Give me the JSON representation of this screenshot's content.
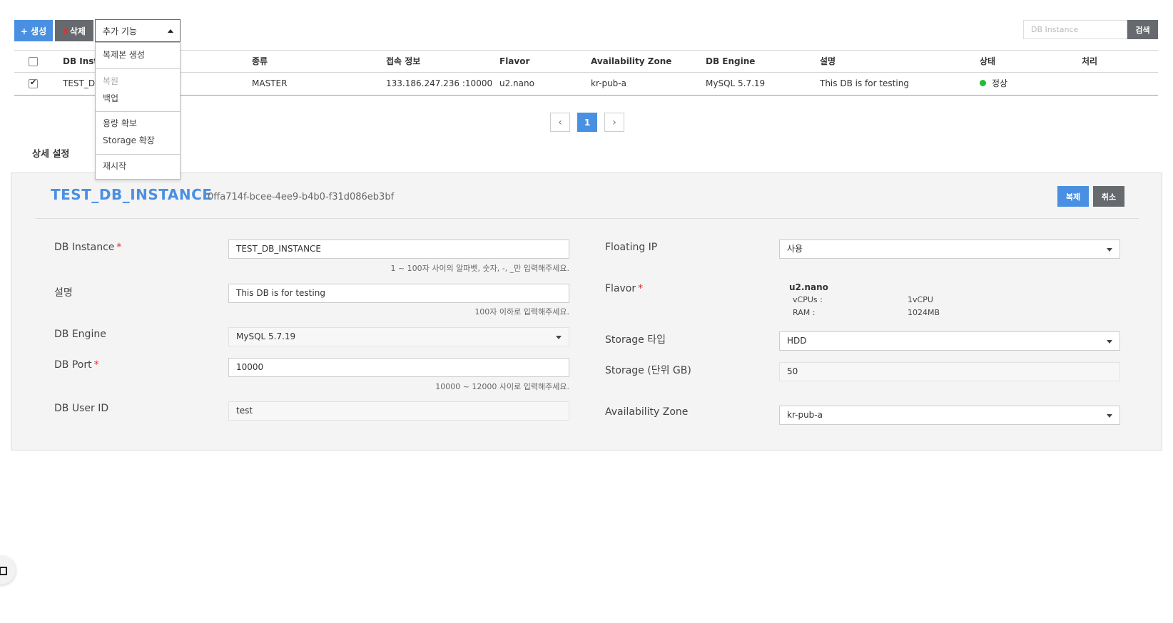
{
  "toolbar": {
    "create_label": "+ 생성",
    "delete_x": "x",
    "delete_label": "삭제",
    "more_label": "추가 기능",
    "search_placeholder": "DB Instance",
    "search_label": "검색"
  },
  "dropdown": {
    "items": [
      {
        "label": "복제본 생성",
        "disabled": false
      },
      {
        "label": "복원",
        "disabled": true
      },
      {
        "label": "백업",
        "disabled": false
      },
      {
        "label": "용량 확보",
        "disabled": false
      },
      {
        "label": "Storage 확장",
        "disabled": false
      },
      {
        "label": "재시작",
        "disabled": false
      }
    ]
  },
  "table": {
    "headers": [
      "DB Inst",
      "종류",
      "접속 정보",
      "Flavor",
      "Availability Zone",
      "DB Engine",
      "설명",
      "상태",
      "처리"
    ],
    "rows": [
      {
        "name": "TEST_D",
        "type": "MASTER",
        "connection": "133.186.247.236 :10000",
        "flavor": "u2.nano",
        "zone": "kr-pub-a",
        "engine": "MySQL 5.7.19",
        "description": "This DB is for testing",
        "status": "정상",
        "status_color": "#22bb33",
        "checked": true
      }
    ]
  },
  "pagination": {
    "prev": "‹",
    "current": "1",
    "next": "›"
  },
  "section_title": "상세 설정",
  "detail": {
    "title": "TEST_DB_INSTANCE",
    "id": "0ffa714f-bcee-4ee9-b4b0-f31d086eb3bf",
    "copy_label": "복제",
    "cancel_label": "취소",
    "db_instance": {
      "label": "DB Instance",
      "value": "TEST_DB_INSTANCE",
      "help": "1 ~ 100자 사이의 알파벳, 숫자, -, _만 입력해주세요."
    },
    "description": {
      "label": "설명",
      "value": "This DB is for testing",
      "help": "100자 이하로 입력해주세요."
    },
    "db_engine": {
      "label": "DB Engine",
      "value": "MySQL 5.7.19"
    },
    "db_port": {
      "label": "DB Port",
      "value": "10000",
      "help": "10000 ~ 12000 사이로 입력해주세요."
    },
    "db_user": {
      "label": "DB User ID",
      "value": "test"
    },
    "floating_ip": {
      "label": "Floating IP",
      "value": "사용"
    },
    "flavor": {
      "label": "Flavor",
      "name": "u2.nano",
      "vcpu_label": "vCPUs :",
      "vcpu_value": "1vCPU",
      "ram_label": "RAM :",
      "ram_value": "1024MB"
    },
    "storage_type": {
      "label": "Storage 타입",
      "value": "HDD"
    },
    "storage_size": {
      "label": "Storage (단위 GB)",
      "value": "50"
    },
    "availability_zone": {
      "label": "Availability Zone",
      "value": "kr-pub-a"
    },
    "required_mark": "*"
  },
  "colors": {
    "primary": "#4a90e2",
    "dark": "#666a6e",
    "required": "#e03030",
    "status_ok": "#22bb33"
  }
}
